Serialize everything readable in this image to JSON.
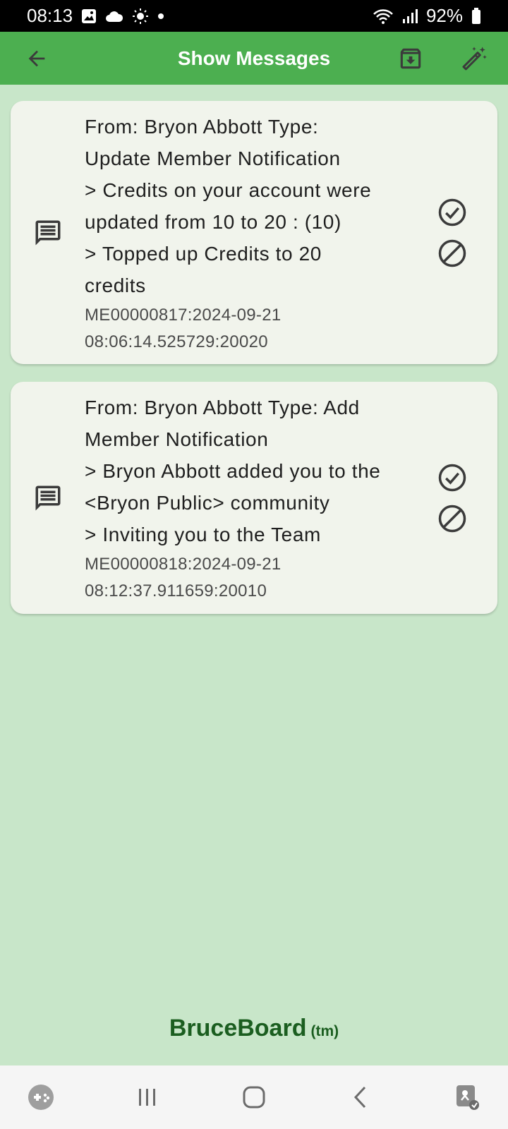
{
  "status_bar": {
    "time": "08:13",
    "battery": "92%",
    "icons": [
      "gallery-icon",
      "cloud-icon",
      "brightness-icon",
      "dot-icon",
      "wifi-icon",
      "signal-icon",
      "battery-icon"
    ]
  },
  "app_bar": {
    "title": "Show Messages",
    "icons": [
      "back-arrow-icon",
      "archive-download-icon",
      "magic-wand-icon"
    ]
  },
  "messages": [
    {
      "lines": [
        "From: Bryon Abbott Type:",
        "Update Member Notification",
        "> Credits on your account were",
        "updated from 10 to 20 : (10)",
        "> Topped up Credits to 20",
        "credits"
      ],
      "id_lines": [
        "ME00000817:2024-09-21",
        "08:06:14.525729:20020"
      ]
    },
    {
      "lines": [
        "From: Bryon Abbott Type: Add",
        "Member Notification",
        "> Bryon Abbott added you to the",
        "<Bryon Public> community",
        "> Inviting you to the Team"
      ],
      "id_lines": [
        "ME00000818:2024-09-21",
        "08:12:37.911659:20010"
      ]
    }
  ],
  "footer": {
    "brand": "BruceBoard",
    "tm": "(tm)"
  },
  "colors": {
    "app_bar": "#4caf50",
    "background": "#c8e6c9",
    "card": "#f1f4ec",
    "brand": "#1b5e20"
  },
  "nav_bar": {
    "icons": [
      "game-launcher-icon",
      "recent-apps-icon",
      "home-icon",
      "back-icon",
      "accessibility-icon"
    ]
  }
}
